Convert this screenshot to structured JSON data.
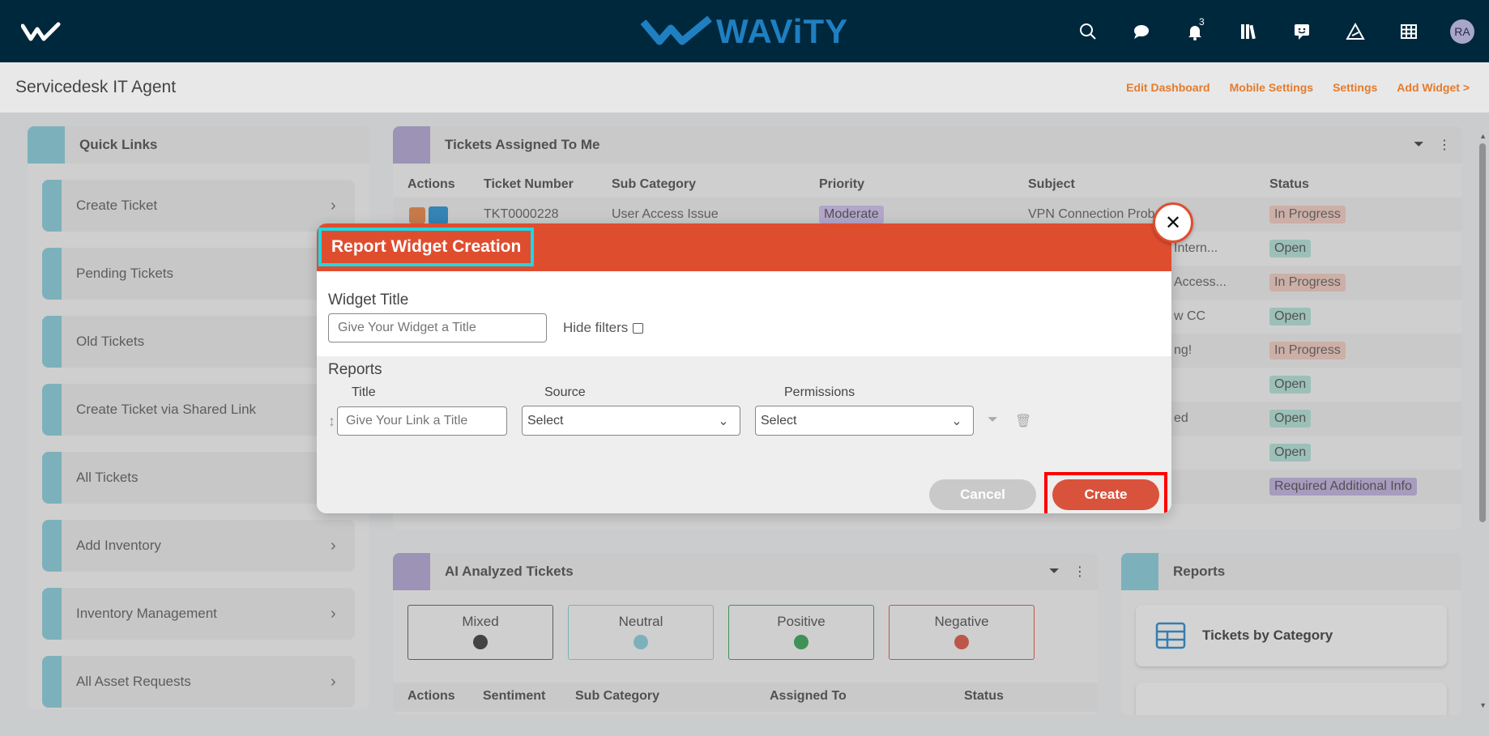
{
  "topbar": {
    "brand": "WAViTY",
    "notification_count": "3",
    "avatar_initials": "RA",
    "icons": [
      "search-icon",
      "chat-icon",
      "bell-icon",
      "library-icon",
      "message-icon",
      "warning-icon",
      "grid-icon"
    ]
  },
  "header": {
    "title": "Servicedesk IT Agent",
    "links": [
      "Edit Dashboard",
      "Mobile Settings",
      "Settings",
      "Add Widget >"
    ]
  },
  "quick_links": {
    "title": "Quick Links",
    "items": [
      "Create Ticket",
      "Pending Tickets",
      "Old Tickets",
      "Create Ticket via Shared Link",
      "All Tickets",
      "Add Inventory",
      "Inventory Management",
      "All Asset Requests"
    ]
  },
  "tickets": {
    "title": "Tickets Assigned To Me",
    "columns": [
      "Actions",
      "Ticket Number",
      "Sub Category",
      "Priority",
      "Subject",
      "Status"
    ],
    "rows": [
      {
        "ticket": "TKT0000228",
        "sub": "User Access Issue",
        "priority": "Moderate",
        "subject": "VPN Connection Prob",
        "status": "In Progress"
      },
      {
        "subject": "Intern...",
        "status": "Open"
      },
      {
        "subject": "Access...",
        "status": "In Progress"
      },
      {
        "subject": "w CC",
        "status": "Open"
      },
      {
        "subject": "ng!",
        "status": "In Progress"
      },
      {
        "subject": "",
        "status": "Open"
      },
      {
        "subject": "ed",
        "status": "Open"
      },
      {
        "subject": "",
        "status": "Open"
      },
      {
        "subject": "",
        "status": "Required Additional Info"
      }
    ]
  },
  "ai_tickets": {
    "title": "AI Analyzed Tickets",
    "sentiments": [
      "Mixed",
      "Neutral",
      "Positive",
      "Negative"
    ],
    "columns": [
      "Actions",
      "Sentiment",
      "Sub Category",
      "Assigned To",
      "Status"
    ]
  },
  "reports_widget": {
    "title": "Reports",
    "cards": [
      "Tickets by Category"
    ]
  },
  "modal": {
    "title": "Report Widget Creation",
    "widget_title_label": "Widget Title",
    "widget_title_placeholder": "Give Your Widget a Title",
    "hide_filters_label": "Hide filters",
    "reports_label": "Reports",
    "col_title": "Title",
    "col_source": "Source",
    "col_permissions": "Permissions",
    "link_title_placeholder": "Give Your Link a Title",
    "source_value": "Select",
    "permissions_value": "Select",
    "cancel_label": "Cancel",
    "create_label": "Create",
    "close_glyph": "✕"
  },
  "colors": {
    "topbar": "#00283d",
    "brand_blue": "#1f7fc1",
    "modal_header": "#df4d2f",
    "link_orange": "#e57b2c",
    "create_button": "#d9533c"
  }
}
